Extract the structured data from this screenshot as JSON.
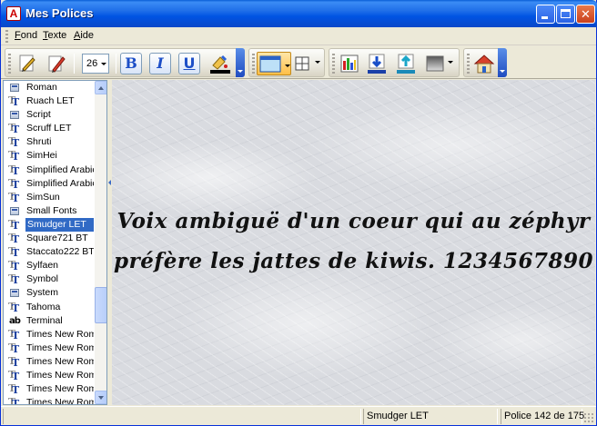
{
  "window": {
    "title": "Mes Polices",
    "app_icon_glyph": "A"
  },
  "menu": {
    "items": [
      {
        "underline": "F",
        "rest": "ond"
      },
      {
        "underline": "T",
        "rest": "exte"
      },
      {
        "underline": "A",
        "rest": "ide"
      }
    ]
  },
  "toolbar": {
    "font_size": "26",
    "bold_glyph": "B",
    "italic_glyph": "I",
    "underline_glyph": "U",
    "icons": [
      "pen-edit-icon",
      "pencil-icon",
      "font-color-icon",
      "background-icon",
      "grid-icon",
      "color-bars-icon",
      "download-icon",
      "upload-icon",
      "gradient-icon",
      "home-icon"
    ]
  },
  "font_list": {
    "items": [
      {
        "name": "Roman",
        "type": "sys"
      },
      {
        "name": "Ruach LET",
        "type": "tt"
      },
      {
        "name": "Script",
        "type": "sys"
      },
      {
        "name": "Scruff LET",
        "type": "tt"
      },
      {
        "name": "Shruti",
        "type": "tt"
      },
      {
        "name": "SimHei",
        "type": "tt"
      },
      {
        "name": "Simplified Arabic",
        "type": "tt"
      },
      {
        "name": "Simplified Arabic",
        "type": "tt"
      },
      {
        "name": "SimSun",
        "type": "tt"
      },
      {
        "name": "Small Fonts",
        "type": "sys"
      },
      {
        "name": "Smudger LET",
        "type": "tt",
        "selected": true
      },
      {
        "name": "Square721 BT",
        "type": "tt"
      },
      {
        "name": "Staccato222 BT",
        "type": "tt"
      },
      {
        "name": "Sylfaen",
        "type": "tt"
      },
      {
        "name": "Symbol",
        "type": "tt"
      },
      {
        "name": "System",
        "type": "sys"
      },
      {
        "name": "Tahoma",
        "type": "tt"
      },
      {
        "name": "Terminal",
        "type": "ab"
      },
      {
        "name": "Times New Rom",
        "type": "tt"
      },
      {
        "name": "Times New Rom",
        "type": "tt"
      },
      {
        "name": "Times New Rom",
        "type": "tt"
      },
      {
        "name": "Times New Rom",
        "type": "tt"
      },
      {
        "name": "Times New Rom",
        "type": "tt"
      },
      {
        "name": "Times New Rom",
        "type": "tt"
      }
    ],
    "scroll_fraction": 0.74
  },
  "preview": {
    "line1": "Voix ambiguë d'un coeur qui au zéphyr",
    "line2": "préfère les jattes de kiwis. 1234567890"
  },
  "status": {
    "font_name": "Smudger LET",
    "position": "Police 142 de 175"
  },
  "colors": {
    "selection": "#316ac5",
    "titlebar": "#0054e3"
  }
}
